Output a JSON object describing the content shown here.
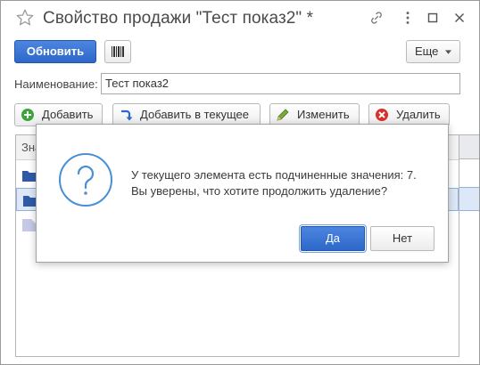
{
  "window": {
    "title": "Свойство продажи \"Тест показ2\" *"
  },
  "toolbar": {
    "refresh_label": "Обновить",
    "more_label": "Еще"
  },
  "form": {
    "name_label": "Наименование:",
    "name_value": "Тест показ2"
  },
  "list_toolbar": {
    "add_label": "Добавить",
    "add_into_label": "Добавить в текущее",
    "edit_label": "Изменить",
    "delete_label": "Удалить"
  },
  "grid": {
    "header_text": "Зна"
  },
  "dialog": {
    "message_line1": "У текущего элемента есть подчиненные значения: 7.",
    "message_line2": "Вы уверены, что хотите продолжить удаление?",
    "yes_label": "Да",
    "no_label": "Нет"
  },
  "icons": {
    "star": "star-icon",
    "link": "link-icon",
    "menu": "more-vertical-icon",
    "maximize": "maximize-icon",
    "close": "close-icon",
    "barcode": "barcode-icon",
    "dropdown": "chevron-down-icon",
    "add": "add-icon",
    "add_into": "add-into-icon",
    "edit": "pencil-icon",
    "delete": "delete-icon",
    "folder": "folder-icon",
    "item": "item-icon",
    "question": "question-icon"
  },
  "colors": {
    "primary": "#2d67c9",
    "delete": "#d9302a",
    "add": "#3aa53a",
    "question": "#4a8fd6",
    "selection": "#dce8f7"
  }
}
